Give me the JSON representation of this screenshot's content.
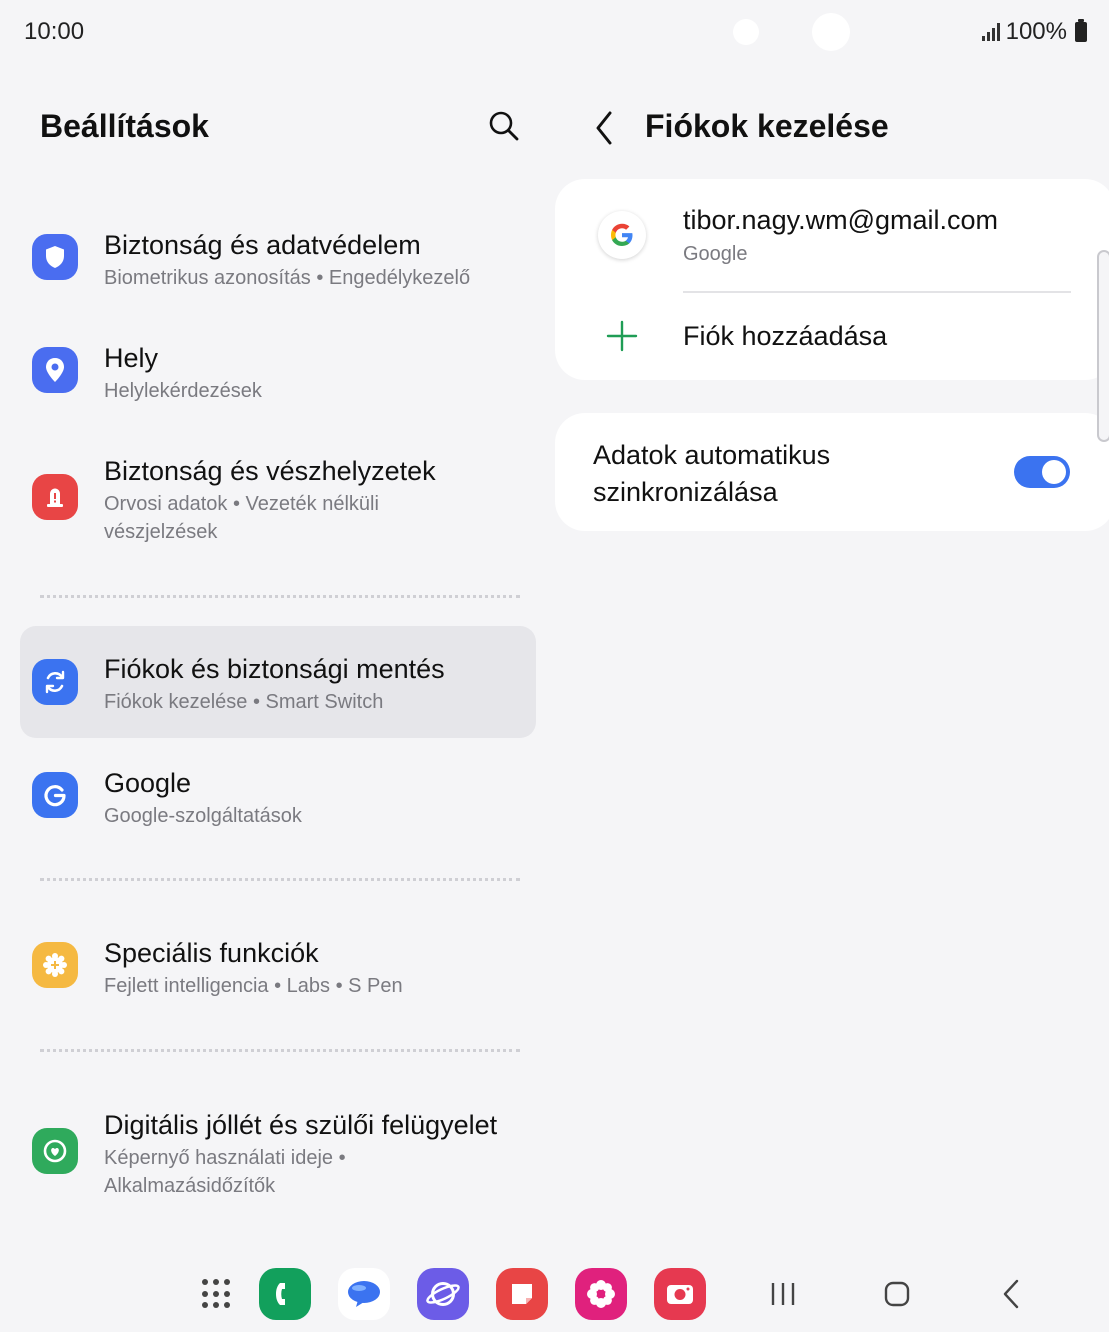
{
  "status_bar": {
    "time": "10:00",
    "battery": "100%"
  },
  "left_panel": {
    "title": "Beállítások",
    "items": [
      {
        "title": "Biztonság és adatvédelem",
        "subtitle": "Biometrikus azonosítás  •  Engedélykezelő",
        "icon": "shield-icon",
        "color": "#4a6df0"
      },
      {
        "title": "Hely",
        "subtitle": "Helylekérdezések",
        "icon": "location-pin-icon",
        "color": "#4a6df0"
      },
      {
        "title": "Biztonság és vészhelyzetek",
        "subtitle": "Orvosi adatok  •  Vezeték nélküli vészjelzések",
        "icon": "emergency-icon",
        "color": "#e84545"
      },
      {
        "title": "Fiókok és biztonsági mentés",
        "subtitle": "Fiókok kezelése  •  Smart Switch",
        "icon": "sync-icon",
        "color": "#3b73f0"
      },
      {
        "title": "Google",
        "subtitle": "Google-szolgáltatások",
        "icon": "google-g-icon",
        "color": "#3b73f0"
      },
      {
        "title": "Speciális funkciók",
        "subtitle": "Fejlett intelligencia  •  Labs  •  S Pen",
        "icon": "gear-plus-icon",
        "color": "#f5b942"
      },
      {
        "title": "Digitális jóllét és szülői felügyelet",
        "subtitle": "Képernyő használati ideje  •  Alkalmazásidőzítők",
        "icon": "wellbeing-icon",
        "color": "#2faa5c"
      }
    ]
  },
  "right_panel": {
    "title": "Fiókok kezelése",
    "account": {
      "email": "tibor.nagy.wm@gmail.com",
      "provider": "Google"
    },
    "add_account_label": "Fiók hozzáadása",
    "sync_label": "Adatok automatikus szinkronizálása",
    "sync_enabled": true
  },
  "dock": {
    "apps": [
      {
        "name": "phone-app-icon",
        "color": "#12a05c"
      },
      {
        "name": "messages-app-icon",
        "color": "#ffffff"
      },
      {
        "name": "internet-app-icon",
        "color": "#6c5ce7"
      },
      {
        "name": "notes-app-icon",
        "color": "#e84545"
      },
      {
        "name": "gallery-app-icon",
        "color": "#e0217d"
      },
      {
        "name": "camera-app-icon",
        "color": "#e63950"
      }
    ]
  }
}
